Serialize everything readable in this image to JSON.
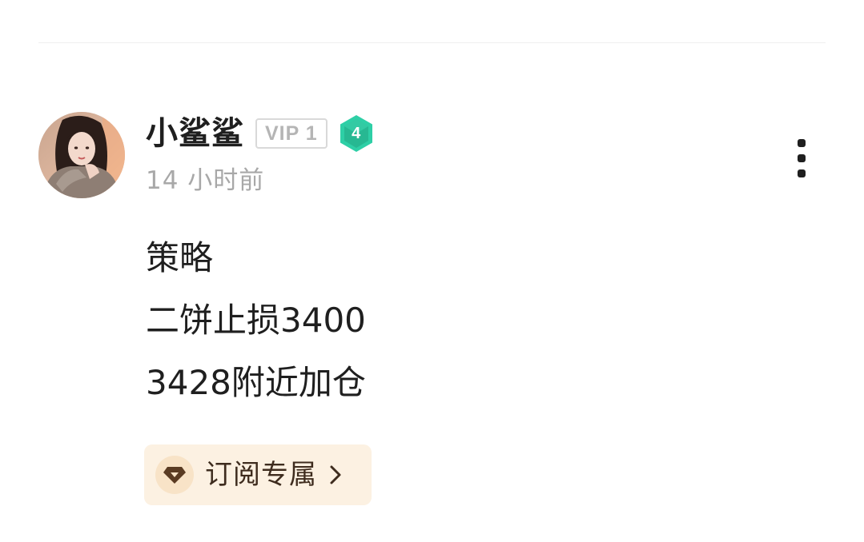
{
  "post": {
    "author": {
      "name": "小鲨鲨",
      "vip_label": "VIP 1",
      "level": "4"
    },
    "timestamp": "14 小时前",
    "content_lines": [
      "策略",
      "二饼止损3400",
      "3428附近加仓"
    ],
    "tag": {
      "label": "订阅专属"
    }
  },
  "icons": {
    "more": "more-vertical-icon",
    "gem": "diamond-icon",
    "chevron": "chevron-right-icon",
    "level_badge": "hexagon-level-badge"
  },
  "colors": {
    "level_badge": "#2ecfa6",
    "vip_border": "#d9d9d9",
    "vip_text": "#b5b5b5",
    "tag_bg": "#fcf1e2",
    "tag_text": "#3e2c1e",
    "timestamp": "#a8a8a8"
  }
}
